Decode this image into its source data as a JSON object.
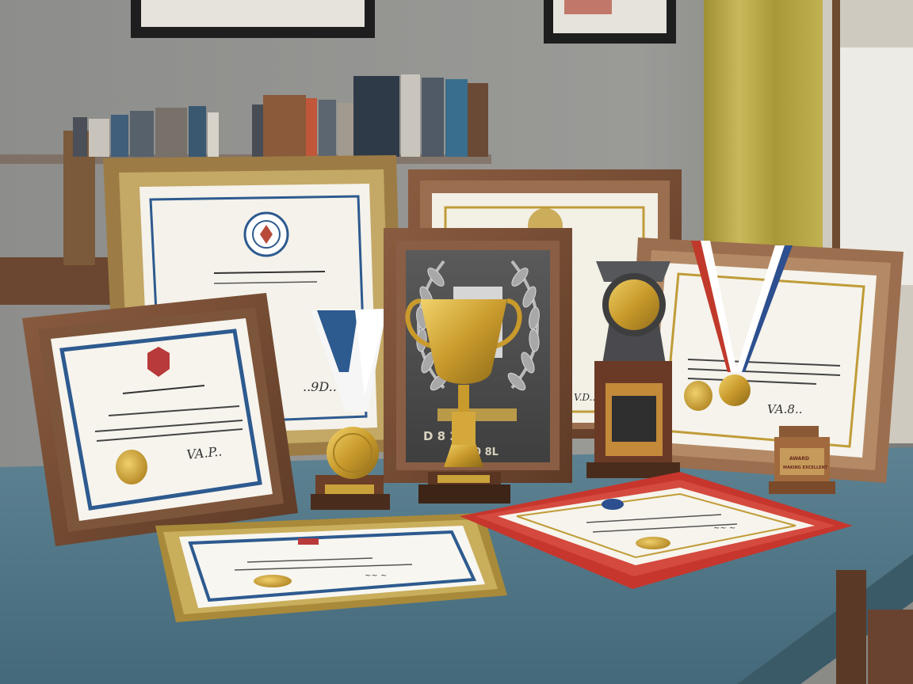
{
  "scene": {
    "plaque_engraving": {
      "line1": "D   8 280",
      "line2": "0 8L"
    },
    "signatures": {
      "front_left_certificate": "VA.P..",
      "back_center_certificate": "..9D..",
      "plaque_frame_bottom": "V.D..",
      "right_medal_certificate": "VA.8..",
      "red_frame_certificate": "~~ ~",
      "gold_frame_certificate": "~~ ~"
    },
    "small_trophy_plate": {
      "line1": "AWARD",
      "line2": "MAKING EXCELLENT"
    },
    "colors": {
      "wall": "#8f8f8c",
      "table_top": "#4f7585",
      "wood_frame": "#7a4e36",
      "gold_frame": "#b39a4a",
      "red_frame": "#c7362c",
      "blue_border": "#2d5a8f",
      "gold_seal": "#cfa53b",
      "curtain": "#b7a744"
    },
    "icons": [
      "laurel-wreath-icon",
      "trophy-cup-icon",
      "medal-icon",
      "emblem-seal-icon"
    ]
  }
}
